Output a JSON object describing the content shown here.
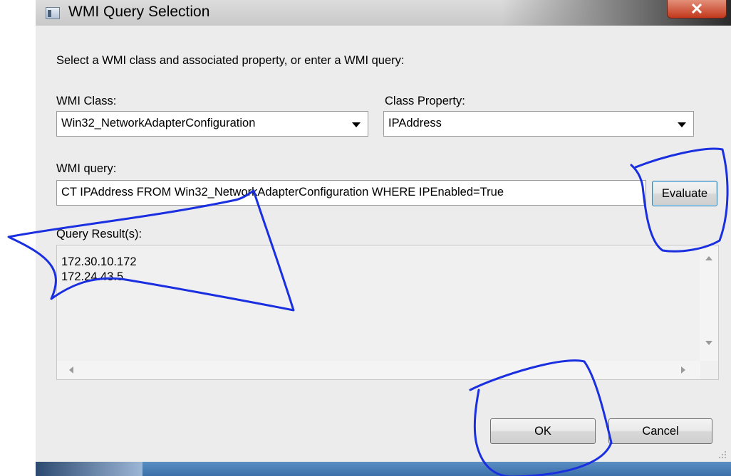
{
  "window": {
    "title": "WMI Query Selection"
  },
  "instruction": "Select a WMI class and associated property, or enter a WMI query:",
  "wmi_class": {
    "label": "WMI Class:",
    "value": "Win32_NetworkAdapterConfiguration"
  },
  "class_property": {
    "label": "Class Property:",
    "value": "IPAddress"
  },
  "wmi_query": {
    "label": "WMI query:",
    "value": "CT IPAddress FROM Win32_NetworkAdapterConfiguration WHERE IPEnabled=True"
  },
  "evaluate_label": "Evaluate",
  "query_results": {
    "label": "Query Result(s):",
    "items": [
      "172.30.10.172",
      "172.24.43.5"
    ]
  },
  "footer": {
    "ok_label": "OK",
    "cancel_label": "Cancel"
  },
  "colors": {
    "annotation": "#1a2fe0",
    "close_button": "#c2381c"
  }
}
